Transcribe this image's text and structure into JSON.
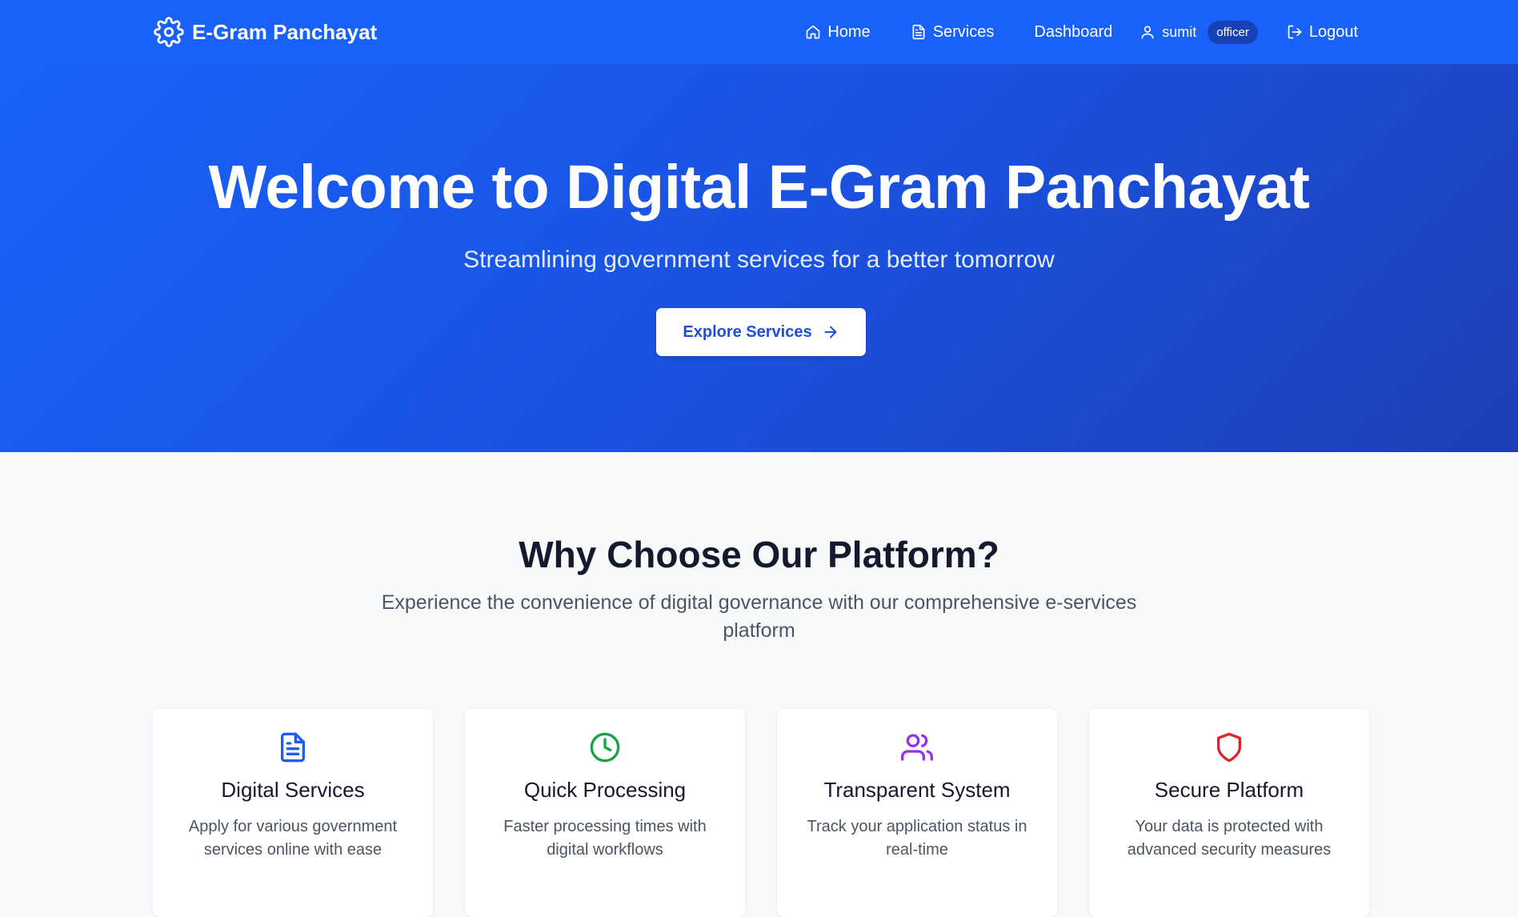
{
  "navbar": {
    "brand": "E-Gram Panchayat",
    "items": {
      "home": "Home",
      "services": "Services",
      "dashboard": "Dashboard",
      "user": "sumit",
      "role": "officer",
      "logout": "Logout"
    }
  },
  "hero": {
    "title": "Welcome to Digital E-Gram Panchayat",
    "subtitle": "Streamlining government services for a better tomorrow",
    "cta": "Explore Services"
  },
  "features": {
    "title": "Why Choose Our Platform?",
    "subtitle": "Experience the convenience of digital governance with our comprehensive e-services platform",
    "cards": [
      {
        "icon": "document-icon",
        "color": "#1f5eea",
        "title": "Digital Services",
        "desc": "Apply for various government services online with ease"
      },
      {
        "icon": "clock-icon",
        "color": "#16a34a",
        "title": "Quick Processing",
        "desc": "Faster processing times with digital workflows"
      },
      {
        "icon": "users-icon",
        "color": "#9333ea",
        "title": "Transparent System",
        "desc": "Track your application status in real-time"
      },
      {
        "icon": "shield-icon",
        "color": "#dc2626",
        "title": "Secure Platform",
        "desc": "Your data is protected with advanced security measures"
      }
    ]
  },
  "colors": {
    "primary": "#1862fa",
    "hero_gradient_end": "#1e3fb4",
    "badge": "#1741b5",
    "page_bg": "#f8f9fb"
  }
}
